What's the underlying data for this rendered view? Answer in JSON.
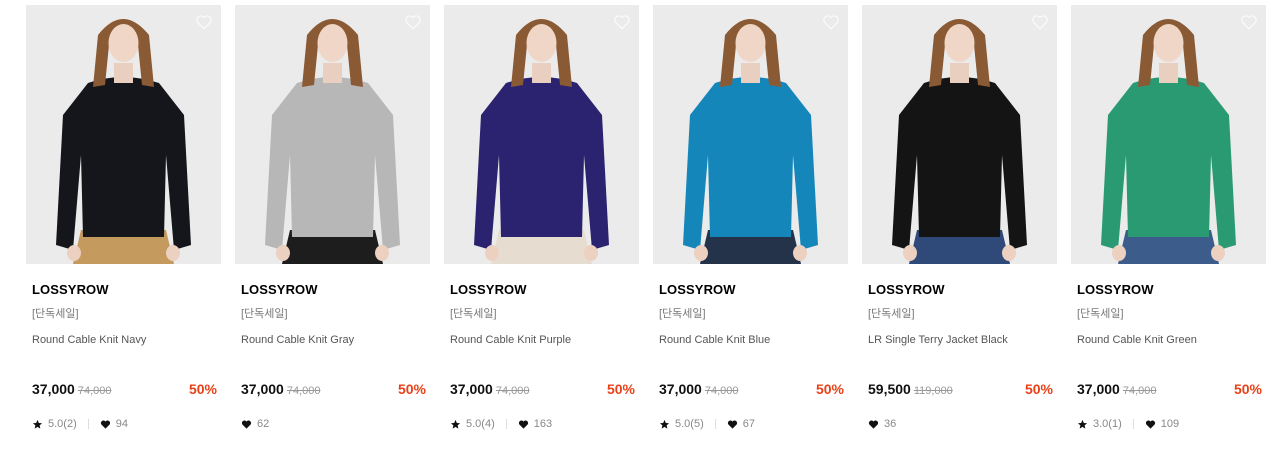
{
  "colors": {
    "discount": "#e8421a",
    "thumb_bg": "#ebebeb"
  },
  "products": [
    {
      "brand": "LOSSYROW",
      "tag": "[단독세일]",
      "name": "Round Cable Knit Navy",
      "price": "37,000",
      "original_price": "74,000",
      "discount": "50%",
      "rating": "5.0(2)",
      "likes": "94",
      "sweater_color": "#14161c",
      "bottom_color": "#c49a5f"
    },
    {
      "brand": "LOSSYROW",
      "tag": "[단독세일]",
      "name": "Round Cable Knit Gray",
      "price": "37,000",
      "original_price": "74,000",
      "discount": "50%",
      "rating": "",
      "likes": "62",
      "sweater_color": "#b7b7b7",
      "bottom_color": "#1d1d1d"
    },
    {
      "brand": "LOSSYROW",
      "tag": "[단독세일]",
      "name": "Round Cable Knit Purple",
      "price": "37,000",
      "original_price": "74,000",
      "discount": "50%",
      "rating": "5.0(4)",
      "likes": "163",
      "sweater_color": "#2b2270",
      "bottom_color": "#e6ddd0"
    },
    {
      "brand": "LOSSYROW",
      "tag": "[단독세일]",
      "name": "Round Cable Knit Blue",
      "price": "37,000",
      "original_price": "74,000",
      "discount": "50%",
      "rating": "5.0(5)",
      "likes": "67",
      "sweater_color": "#1586b9",
      "bottom_color": "#24324a"
    },
    {
      "brand": "LOSSYROW",
      "tag": "[단독세일]",
      "name": "LR Single Terry Jacket Black",
      "price": "59,500",
      "original_price": "119,000",
      "discount": "50%",
      "rating": "",
      "likes": "36",
      "sweater_color": "#141414",
      "bottom_color": "#2f4a78"
    },
    {
      "brand": "LOSSYROW",
      "tag": "[단독세일]",
      "name": "Round Cable Knit Green",
      "price": "37,000",
      "original_price": "74,000",
      "discount": "50%",
      "rating": "3.0(1)",
      "likes": "109",
      "sweater_color": "#2a9a73",
      "bottom_color": "#3c5d8c"
    }
  ]
}
